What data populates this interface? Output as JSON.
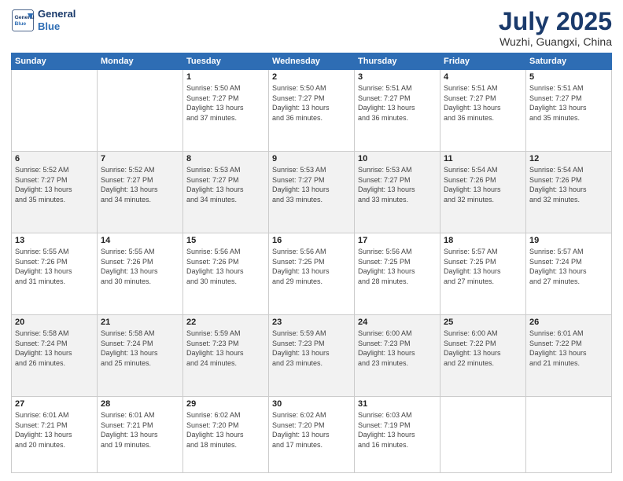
{
  "header": {
    "logo_line1": "General",
    "logo_line2": "Blue",
    "month_year": "July 2025",
    "location": "Wuzhi, Guangxi, China"
  },
  "weekdays": [
    "Sunday",
    "Monday",
    "Tuesday",
    "Wednesday",
    "Thursday",
    "Friday",
    "Saturday"
  ],
  "weeks": [
    [
      {
        "day": "",
        "info": ""
      },
      {
        "day": "",
        "info": ""
      },
      {
        "day": "1",
        "info": "Sunrise: 5:50 AM\nSunset: 7:27 PM\nDaylight: 13 hours\nand 37 minutes."
      },
      {
        "day": "2",
        "info": "Sunrise: 5:50 AM\nSunset: 7:27 PM\nDaylight: 13 hours\nand 36 minutes."
      },
      {
        "day": "3",
        "info": "Sunrise: 5:51 AM\nSunset: 7:27 PM\nDaylight: 13 hours\nand 36 minutes."
      },
      {
        "day": "4",
        "info": "Sunrise: 5:51 AM\nSunset: 7:27 PM\nDaylight: 13 hours\nand 36 minutes."
      },
      {
        "day": "5",
        "info": "Sunrise: 5:51 AM\nSunset: 7:27 PM\nDaylight: 13 hours\nand 35 minutes."
      }
    ],
    [
      {
        "day": "6",
        "info": "Sunrise: 5:52 AM\nSunset: 7:27 PM\nDaylight: 13 hours\nand 35 minutes."
      },
      {
        "day": "7",
        "info": "Sunrise: 5:52 AM\nSunset: 7:27 PM\nDaylight: 13 hours\nand 34 minutes."
      },
      {
        "day": "8",
        "info": "Sunrise: 5:53 AM\nSunset: 7:27 PM\nDaylight: 13 hours\nand 34 minutes."
      },
      {
        "day": "9",
        "info": "Sunrise: 5:53 AM\nSunset: 7:27 PM\nDaylight: 13 hours\nand 33 minutes."
      },
      {
        "day": "10",
        "info": "Sunrise: 5:53 AM\nSunset: 7:27 PM\nDaylight: 13 hours\nand 33 minutes."
      },
      {
        "day": "11",
        "info": "Sunrise: 5:54 AM\nSunset: 7:26 PM\nDaylight: 13 hours\nand 32 minutes."
      },
      {
        "day": "12",
        "info": "Sunrise: 5:54 AM\nSunset: 7:26 PM\nDaylight: 13 hours\nand 32 minutes."
      }
    ],
    [
      {
        "day": "13",
        "info": "Sunrise: 5:55 AM\nSunset: 7:26 PM\nDaylight: 13 hours\nand 31 minutes."
      },
      {
        "day": "14",
        "info": "Sunrise: 5:55 AM\nSunset: 7:26 PM\nDaylight: 13 hours\nand 30 minutes."
      },
      {
        "day": "15",
        "info": "Sunrise: 5:56 AM\nSunset: 7:26 PM\nDaylight: 13 hours\nand 30 minutes."
      },
      {
        "day": "16",
        "info": "Sunrise: 5:56 AM\nSunset: 7:25 PM\nDaylight: 13 hours\nand 29 minutes."
      },
      {
        "day": "17",
        "info": "Sunrise: 5:56 AM\nSunset: 7:25 PM\nDaylight: 13 hours\nand 28 minutes."
      },
      {
        "day": "18",
        "info": "Sunrise: 5:57 AM\nSunset: 7:25 PM\nDaylight: 13 hours\nand 27 minutes."
      },
      {
        "day": "19",
        "info": "Sunrise: 5:57 AM\nSunset: 7:24 PM\nDaylight: 13 hours\nand 27 minutes."
      }
    ],
    [
      {
        "day": "20",
        "info": "Sunrise: 5:58 AM\nSunset: 7:24 PM\nDaylight: 13 hours\nand 26 minutes."
      },
      {
        "day": "21",
        "info": "Sunrise: 5:58 AM\nSunset: 7:24 PM\nDaylight: 13 hours\nand 25 minutes."
      },
      {
        "day": "22",
        "info": "Sunrise: 5:59 AM\nSunset: 7:23 PM\nDaylight: 13 hours\nand 24 minutes."
      },
      {
        "day": "23",
        "info": "Sunrise: 5:59 AM\nSunset: 7:23 PM\nDaylight: 13 hours\nand 23 minutes."
      },
      {
        "day": "24",
        "info": "Sunrise: 6:00 AM\nSunset: 7:23 PM\nDaylight: 13 hours\nand 23 minutes."
      },
      {
        "day": "25",
        "info": "Sunrise: 6:00 AM\nSunset: 7:22 PM\nDaylight: 13 hours\nand 22 minutes."
      },
      {
        "day": "26",
        "info": "Sunrise: 6:01 AM\nSunset: 7:22 PM\nDaylight: 13 hours\nand 21 minutes."
      }
    ],
    [
      {
        "day": "27",
        "info": "Sunrise: 6:01 AM\nSunset: 7:21 PM\nDaylight: 13 hours\nand 20 minutes."
      },
      {
        "day": "28",
        "info": "Sunrise: 6:01 AM\nSunset: 7:21 PM\nDaylight: 13 hours\nand 19 minutes."
      },
      {
        "day": "29",
        "info": "Sunrise: 6:02 AM\nSunset: 7:20 PM\nDaylight: 13 hours\nand 18 minutes."
      },
      {
        "day": "30",
        "info": "Sunrise: 6:02 AM\nSunset: 7:20 PM\nDaylight: 13 hours\nand 17 minutes."
      },
      {
        "day": "31",
        "info": "Sunrise: 6:03 AM\nSunset: 7:19 PM\nDaylight: 13 hours\nand 16 minutes."
      },
      {
        "day": "",
        "info": ""
      },
      {
        "day": "",
        "info": ""
      }
    ]
  ]
}
